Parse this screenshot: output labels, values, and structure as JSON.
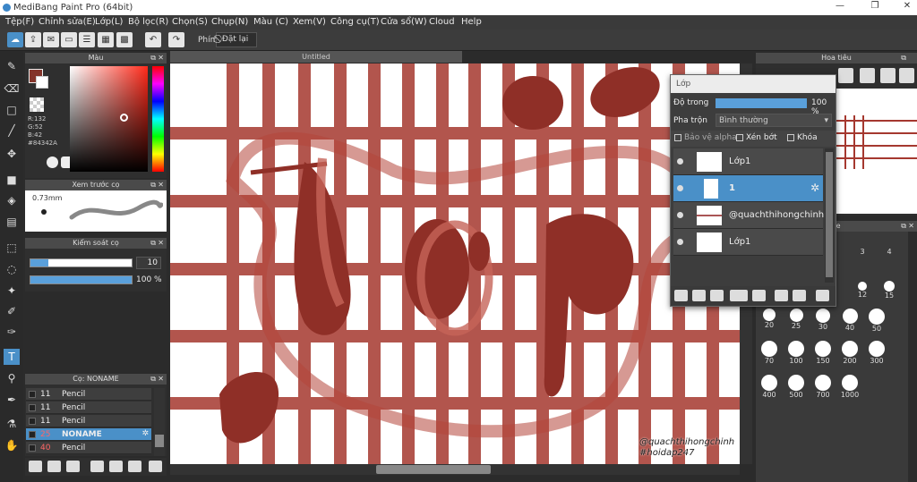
{
  "window": {
    "title": "MediBang Paint Pro (64bit)"
  },
  "menu": [
    "Tệp(F)",
    "Chỉnh sửa(E)",
    "Lớp(L)",
    "Bộ lọc(R)",
    "Chọn(S)",
    "Chụp(N)",
    "Màu (C)",
    "Xem(V)",
    "Công cụ(T)",
    "Cửa sổ(W)",
    "Cloud",
    "Help"
  ],
  "toolbar": {
    "phim_label": "Phím",
    "reset_label": "Đặt lại"
  },
  "color_panel": {
    "title": "Màu",
    "primary": "#84342A",
    "r": "R:132",
    "g": "G:52",
    "b": "B:42",
    "hex": "#84342A"
  },
  "brush_preview": {
    "title": "Xem trước cọ",
    "size": "0.73mm"
  },
  "brush_control": {
    "title": "Kiểm soát cọ",
    "size_value": "10",
    "opacity_value": "100 %"
  },
  "brush_list": {
    "title": "Cọ: NONAME",
    "items": [
      {
        "size": "11",
        "name": "Pencil"
      },
      {
        "size": "11",
        "name": "Pencil"
      },
      {
        "size": "11",
        "name": "Pencil"
      },
      {
        "size": "25",
        "name": "NONAME"
      },
      {
        "size": "40",
        "name": "Pencil"
      }
    ]
  },
  "canvas": {
    "tab": "Untitled",
    "watermark1": "@quachthihongchinh",
    "watermark2": "#hoidap247",
    "accent": "#a5382f"
  },
  "layer_panel": {
    "title": "Lớp",
    "opacity_label": "Độ trong",
    "opacity_value": "100 %",
    "blend_label": "Pha trộn",
    "blend_value": "Bình thường",
    "protect_alpha": "Bảo vệ alpha",
    "clip": "Xén bớt",
    "lock": "Khóa",
    "layers": [
      {
        "name": "Lớp1"
      },
      {
        "name": "1"
      },
      {
        "name": "@quachthihongchinh"
      },
      {
        "name": "Lớp1"
      }
    ]
  },
  "navigator": {
    "title": "Hoa tiêu"
  },
  "brush_size_panel": {
    "title": "ze",
    "sizes": [
      "3",
      "4",
      "12",
      "15",
      "20",
      "25",
      "30",
      "40",
      "50",
      "70",
      "100",
      "150",
      "200",
      "300",
      "400",
      "500",
      "700",
      "1000"
    ]
  }
}
